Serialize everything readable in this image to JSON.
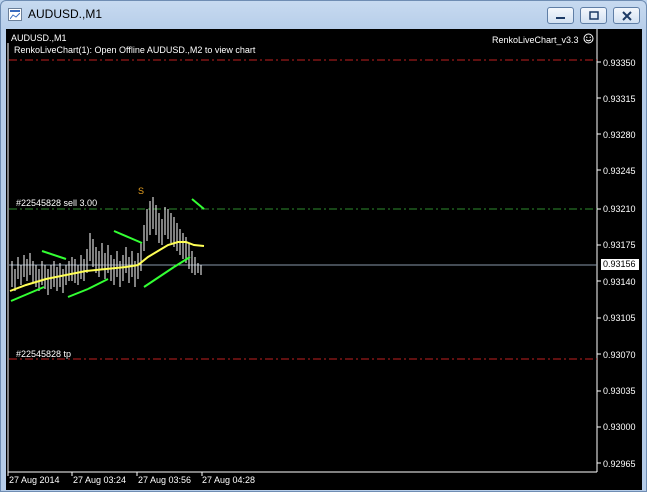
{
  "window": {
    "title": "AUDUSD.,M1"
  },
  "chart": {
    "symbol_label": "AUDUSD.,M1",
    "overlay_text": "RenkoLiveChart(1): Open Offline AUDUSD.,M2 to view chart",
    "indicator_label": "RenkoLiveChart_v3.3",
    "order_sell_label": "#22545828 sell 3.00",
    "order_tp_label": "#22545828 tp",
    "signal_marker": "S",
    "current_price": "0.93156",
    "price_labels": [
      "0.93350",
      "0.93315",
      "0.93280",
      "0.93245",
      "0.93210",
      "0.93175",
      "0.93140",
      "0.93105",
      "0.93070",
      "0.93035",
      "0.93000",
      "0.92965"
    ],
    "time_labels": [
      "27 Aug 2014",
      "27 Aug 03:24",
      "27 Aug 03:56",
      "27 Aug 04:28"
    ],
    "colors": {
      "background": "#000000",
      "candles": "#ffffff",
      "ma_line": "#ffff55",
      "trend_segments": "#33ff33",
      "sell_level": "#2e8b2e",
      "stop_levels": "#c02020",
      "current_price_line": "#8899aa"
    }
  }
}
